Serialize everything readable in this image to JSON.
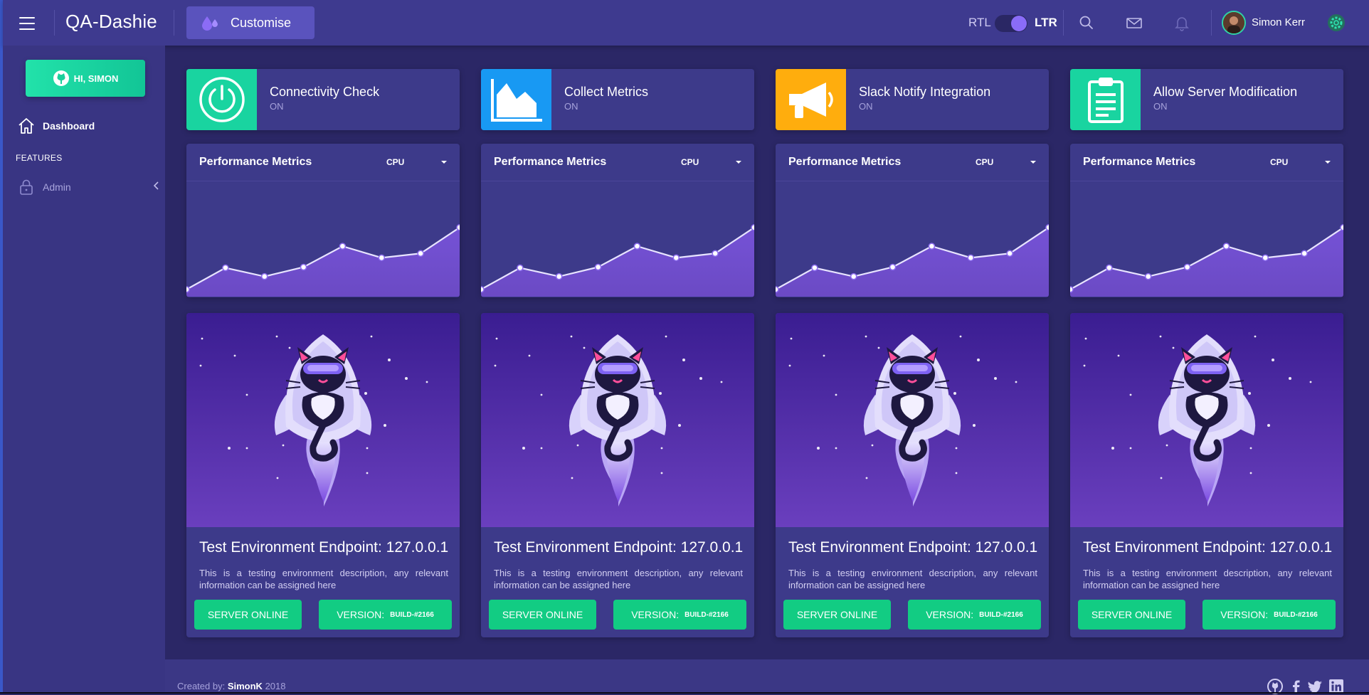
{
  "app": {
    "title": "QA-Dashie"
  },
  "header": {
    "customise_label": "Customise",
    "rtl_label": "RTL",
    "ltr_label": "LTR",
    "user_name": "Simon Kerr",
    "icons": [
      "menu-icon",
      "droplets-icon",
      "search-icon",
      "mail-icon",
      "bell-icon",
      "settings-icon"
    ]
  },
  "sidebar": {
    "greeting": "HI, SIMON",
    "dashboard_label": "Dashboard",
    "features_label": "FEATURES",
    "admin_label": "Admin"
  },
  "stats": [
    {
      "title": "Connectivity Check",
      "status": "ON",
      "icon": "power-icon",
      "color": "#19d4a0"
    },
    {
      "title": "Collect Metrics",
      "status": "ON",
      "icon": "area-chart-icon",
      "color": "#1899f3"
    },
    {
      "title": "Slack Notify Integration",
      "status": "ON",
      "icon": "megaphone-icon",
      "color": "#ffad0d"
    },
    {
      "title": "Allow Server Modification",
      "status": "ON",
      "icon": "clipboard-icon",
      "color": "#19d4a0"
    }
  ],
  "perf": {
    "title": "Performance Metrics",
    "select_value": "CPU"
  },
  "chart_data": {
    "type": "area",
    "values": [
      1.0,
      4.0,
      2.8,
      4.1,
      7.0,
      5.4,
      6.0,
      9.6
    ],
    "ylim": [
      0,
      16
    ]
  },
  "env": {
    "title": "Test Environment Endpoint: 127.0.0.1",
    "description": "This is a testing environment description, any relevant information can be assigned here",
    "status_button": "SERVER ONLINE",
    "version_label": "VERSION:",
    "version_value": "BUILD-#2166"
  },
  "footer": {
    "created_by": "Created by:",
    "author": "SimonK",
    "year": "2018",
    "social": [
      "github-icon",
      "facebook-icon",
      "twitter-icon",
      "linkedin-icon"
    ]
  },
  "colors": {
    "background": "#2b2766",
    "topbar": "#3e3a8f",
    "card": "#3d3a8a",
    "accent_green": "#12cc83",
    "accent_purple": "#8a6cf8"
  }
}
